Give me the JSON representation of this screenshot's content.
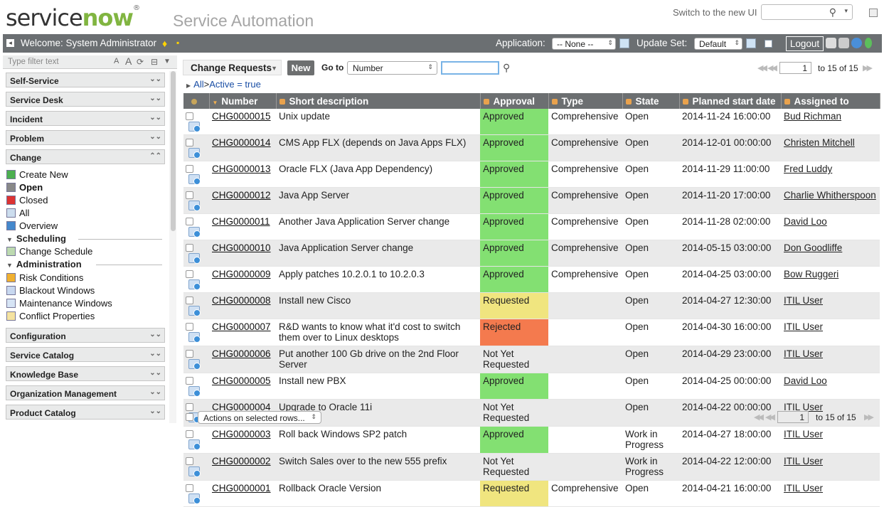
{
  "header": {
    "logo_part1": "service",
    "logo_part2": "now",
    "logo_tm": "®",
    "app_title": "Service Automation",
    "switch_ui_label": "Switch to the new UI"
  },
  "bar": {
    "welcome": "Welcome: System Administrator",
    "application_label": "Application:",
    "application_value": "-- None --",
    "update_set_label": "Update Set:",
    "update_set_value": "Default",
    "logout_label": "Logout"
  },
  "sidebar": {
    "filter_placeholder": "Type filter text",
    "sections_top": [
      "Self-Service",
      "Service Desk",
      "Incident",
      "Problem",
      "Change"
    ],
    "change_items": [
      {
        "label": "Create New",
        "icon": "create-new-icon",
        "bold": false
      },
      {
        "label": "Open",
        "icon": "open-icon",
        "bold": true
      },
      {
        "label": "Closed",
        "icon": "closed-icon",
        "bold": false
      },
      {
        "label": "All",
        "icon": "all-list-icon",
        "bold": false
      },
      {
        "label": "Overview",
        "icon": "overview-chart-icon",
        "bold": false
      }
    ],
    "scheduling_label": "Scheduling",
    "scheduling_items": [
      {
        "label": "Change Schedule",
        "icon": "schedule-icon"
      }
    ],
    "administration_label": "Administration",
    "administration_items": [
      {
        "label": "Risk Conditions",
        "icon": "risk-icon"
      },
      {
        "label": "Blackout Windows",
        "icon": "blackout-icon"
      },
      {
        "label": "Maintenance Windows",
        "icon": "maintenance-icon"
      },
      {
        "label": "Conflict Properties",
        "icon": "conflict-icon"
      }
    ],
    "sections_bottom": [
      "Configuration",
      "Service Catalog",
      "Knowledge Base",
      "Organization Management",
      "Product Catalog"
    ]
  },
  "list": {
    "title": "Change Requests",
    "new_button": "New",
    "goto_label": "Go to",
    "goto_field": "Number",
    "search_value": "",
    "page_value": "1",
    "page_range": "to 15 of 15",
    "breadcrumb_all": "All",
    "breadcrumb_sep": ">",
    "breadcrumb_filter": "Active = true",
    "columns": [
      "Number",
      "Short description",
      "Approval",
      "Type",
      "State",
      "Planned start date",
      "Assigned to"
    ],
    "rows": [
      {
        "number": "CHG0000015",
        "desc": "Unix update",
        "approval": "Approved",
        "ap": "approved",
        "type": "Comprehensive",
        "state": "Open",
        "start": "2014-11-24 16:00:00",
        "assigned": "Bud Richman"
      },
      {
        "number": "CHG0000014",
        "desc": "CMS App FLX (depends on Java Apps FLX)",
        "approval": "Approved",
        "ap": "approved",
        "type": "Comprehensive",
        "state": "Open",
        "start": "2014-12-01 00:00:00",
        "assigned": "Christen Mitchell"
      },
      {
        "number": "CHG0000013",
        "desc": "Oracle FLX (Java App Dependency)",
        "approval": "Approved",
        "ap": "approved",
        "type": "Comprehensive",
        "state": "Open",
        "start": "2014-11-29 11:00:00",
        "assigned": "Fred Luddy"
      },
      {
        "number": "CHG0000012",
        "desc": "Java App Server",
        "approval": "Approved",
        "ap": "approved",
        "type": "Comprehensive",
        "state": "Open",
        "start": "2014-11-20 17:00:00",
        "assigned": "Charlie Whitherspoon"
      },
      {
        "number": "CHG0000011",
        "desc": "Another Java Application Server change",
        "approval": "Approved",
        "ap": "approved",
        "type": "Comprehensive",
        "state": "Open",
        "start": "2014-11-28 02:00:00",
        "assigned": "David Loo"
      },
      {
        "number": "CHG0000010",
        "desc": "Java Application Server change",
        "approval": "Approved",
        "ap": "approved",
        "type": "Comprehensive",
        "state": "Open",
        "start": "2014-05-15 03:00:00",
        "assigned": "Don Goodliffe"
      },
      {
        "number": "CHG0000009",
        "desc": "Apply patches 10.2.0.1 to 10.2.0.3",
        "approval": "Approved",
        "ap": "approved",
        "type": "Comprehensive",
        "state": "Open",
        "start": "2014-04-25 03:00:00",
        "assigned": "Bow Ruggeri"
      },
      {
        "number": "CHG0000008",
        "desc": "Install new Cisco",
        "approval": "Requested",
        "ap": "requested",
        "type": "",
        "state": "Open",
        "start": "2014-04-27 12:30:00",
        "assigned": "ITIL User"
      },
      {
        "number": "CHG0000007",
        "desc": "R&D wants to know what it'd cost to switch them over to Linux desktops",
        "approval": "Rejected",
        "ap": "rejected",
        "type": "",
        "state": "Open",
        "start": "2014-04-30 16:00:00",
        "assigned": "ITIL User"
      },
      {
        "number": "CHG0000006",
        "desc": "Put another 100 Gb drive on the 2nd Floor Server",
        "approval": "Not Yet Requested",
        "ap": "none",
        "type": "",
        "state": "Open",
        "start": "2014-04-29 23:00:00",
        "assigned": "ITIL User"
      },
      {
        "number": "CHG0000005",
        "desc": "Install new PBX",
        "approval": "Approved",
        "ap": "approved",
        "type": "",
        "state": "Open",
        "start": "2014-04-25 00:00:00",
        "assigned": "David Loo"
      },
      {
        "number": "CHG0000004",
        "desc": "Upgrade to Oracle 11i",
        "approval": "Not Yet Requested",
        "ap": "none",
        "type": "",
        "state": "Open",
        "start": "2014-04-22 00:00:00",
        "assigned": "ITIL User"
      },
      {
        "number": "CHG0000003",
        "desc": "Roll back Windows SP2 patch",
        "approval": "Approved",
        "ap": "approved",
        "type": "",
        "state": "Work in Progress",
        "start": "2014-04-27 18:00:00",
        "assigned": "ITIL User"
      },
      {
        "number": "CHG0000002",
        "desc": "Switch Sales over to the new 555 prefix",
        "approval": "Not Yet Requested",
        "ap": "none",
        "type": "",
        "state": "Work in Progress",
        "start": "2014-04-22 12:00:00",
        "assigned": "ITIL User"
      },
      {
        "number": "CHG0000001",
        "desc": "Rollback Oracle Version",
        "approval": "Requested",
        "ap": "requested",
        "type": "Comprehensive",
        "state": "Open",
        "start": "2014-04-21 16:00:00",
        "assigned": "ITIL User"
      }
    ],
    "actions_label": "Actions on selected rows...",
    "bottom_page_value": "1",
    "bottom_page_range": "to 15 of 15"
  },
  "colors": {
    "approved": "#83e072",
    "requested": "#f0e57f",
    "rejected": "#f47a4e",
    "header_bar": "#6b6f72",
    "logo_accent": "#81b541",
    "link": "#1a4ea5"
  }
}
